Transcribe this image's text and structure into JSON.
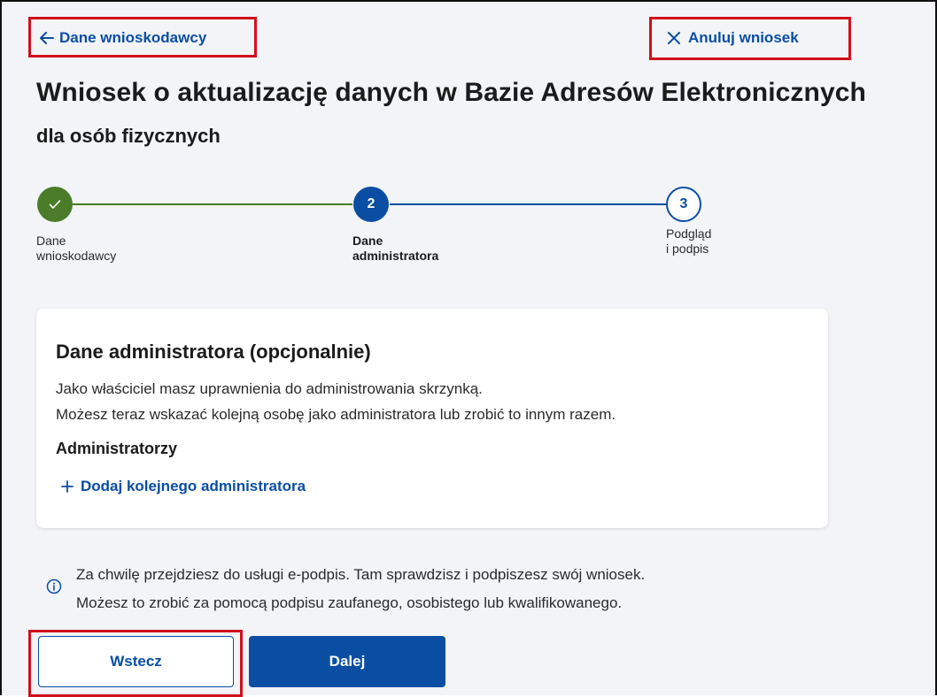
{
  "nav": {
    "back_label": "Dane wnioskodawcy",
    "cancel_label": "Anuluj wniosek"
  },
  "header": {
    "title": "Wniosek o aktualizację danych w Bazie Adresów Elektronicznych",
    "subtitle": "dla osób fizycznych"
  },
  "stepper": {
    "steps": [
      {
        "number": "",
        "label_line1": "Dane",
        "label_line2": "wnioskodawcy",
        "state": "done"
      },
      {
        "number": "2",
        "label_line1": "Dane",
        "label_line2": "administratora",
        "state": "active"
      },
      {
        "number": "3",
        "label_line1": "Podgląd",
        "label_line2": "i podpis",
        "state": "todo"
      }
    ]
  },
  "card": {
    "title": "Dane administratora (opcjonalnie)",
    "text_line1": "Jako właściciel masz uprawnienia do administrowania skrzynką.",
    "text_line2": "Możesz teraz wskazać kolejną osobę jako administratora lub zrobić to innym razem.",
    "section_title": "Administratorzy",
    "add_label": "Dodaj kolejnego administratora"
  },
  "info": {
    "line1": "Za chwilę przejdziesz do usługi e-podpis. Tam sprawdzisz i podpiszesz swój wniosek.",
    "line2": "Możesz to zrobić za pomocą podpisu zaufanego, osobistego lub kwalifikowanego."
  },
  "buttons": {
    "back_label": "Wstecz",
    "next_label": "Dalej"
  },
  "colors": {
    "primary": "#0a4ea4",
    "success": "#4a7c2a",
    "highlight": "#d0101b",
    "background": "#f2f4f7"
  },
  "icons": {
    "back": "arrow-left-icon",
    "cancel": "close-icon",
    "done": "check-icon",
    "add": "plus-icon",
    "info": "info-icon"
  }
}
